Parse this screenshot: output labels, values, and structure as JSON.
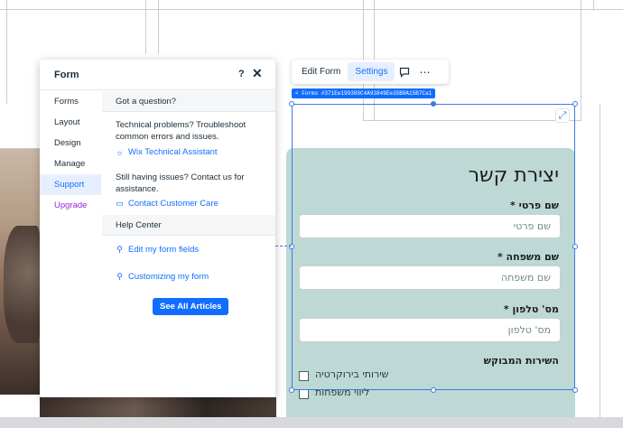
{
  "panel": {
    "title": "Form",
    "help_icon": "?",
    "close_icon": "✕",
    "nav": [
      {
        "label": "Forms"
      },
      {
        "label": "Layout"
      },
      {
        "label": "Design"
      },
      {
        "label": "Manage"
      },
      {
        "label": "Support",
        "active": true
      },
      {
        "label": "Upgrade"
      }
    ],
    "support": {
      "question_heading": "Got a question?",
      "technical_text": "Technical problems? Troubleshoot common errors and issues.",
      "technical_link": "Wix Technical Assistant",
      "still_text": "Still having issues? Contact us for assistance.",
      "contact_link": "Contact Customer Care",
      "help_center_heading": "Help Center",
      "articles": [
        "Edit my form fields",
        "Customizing my form"
      ],
      "see_all_button": "See All Articles"
    }
  },
  "toolbar": {
    "edit_form": "Edit Form",
    "settings": "Settings",
    "comment_icon": "comment-icon",
    "more_icon": "⋯"
  },
  "element_id": "< Forms #371Ee199389C4A93849Ee35B8A15B7Ca1",
  "form": {
    "title": "יצירת קשר",
    "fields": [
      {
        "label": "שם פרטי *",
        "placeholder": "שם פרטי"
      },
      {
        "label": "שם משפחה *",
        "placeholder": "שם משפחה"
      },
      {
        "label": "מס' טלפון *",
        "placeholder": "מס' טלפון"
      }
    ],
    "service_label": "השירות המבוקש",
    "services": [
      "שירותי בירוקרטיה",
      "ליווי משפחות"
    ]
  },
  "colors": {
    "accent": "#116dff",
    "form_bg": "#bdd8d5",
    "selection": "#3b7ce0",
    "upgrade": "#9a27d5"
  }
}
